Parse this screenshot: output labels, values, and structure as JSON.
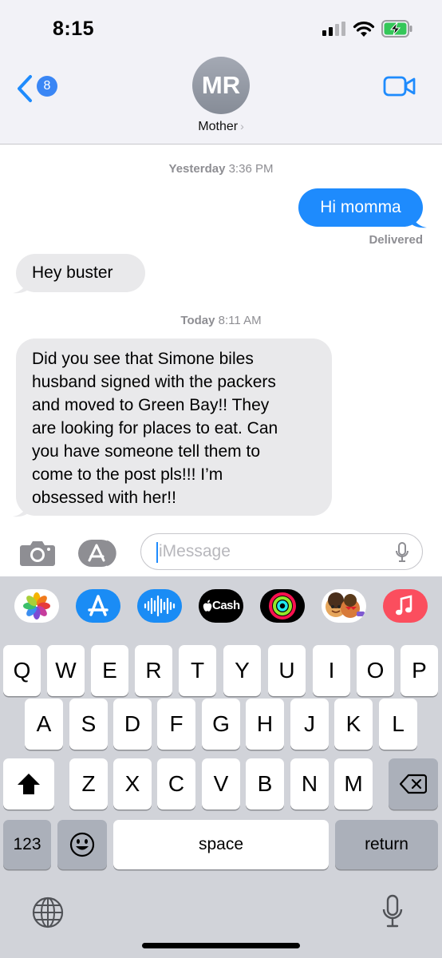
{
  "status_bar": {
    "time": "8:15"
  },
  "header": {
    "back_badge": "8",
    "avatar_initials": "MR",
    "contact_name": "Mother",
    "chevron": "›"
  },
  "messages": {
    "timestamp1_day": "Yesterday",
    "timestamp1_time": "3:36 PM",
    "outgoing1": "Hi momma",
    "delivered": "Delivered",
    "incoming1": "Hey buster",
    "timestamp2_day": "Today",
    "timestamp2_time": "8:11 AM",
    "incoming2_lines": [
      "Did you see that Simone biles",
      "husband signed with the packers",
      "and moved to Green Bay!! They",
      "are looking for places to eat. Can",
      "you have someone tell them to",
      "come to the post pls!!! I’m",
      "obsessed with her!!"
    ]
  },
  "compose": {
    "placeholder": "iMessage"
  },
  "app_strip": {
    "apps": [
      "photos-app",
      "app-store-app",
      "audio-message-app",
      "apple-cash-app",
      "activity-app",
      "memoji-app",
      "music-app"
    ],
    "cash_label": "Cash"
  },
  "keyboard": {
    "row1": [
      "Q",
      "W",
      "E",
      "R",
      "T",
      "Y",
      "U",
      "I",
      "O",
      "P"
    ],
    "row2": [
      "A",
      "S",
      "D",
      "F",
      "G",
      "H",
      "J",
      "K",
      "L"
    ],
    "row3": [
      "Z",
      "X",
      "C",
      "V",
      "B",
      "N",
      "M"
    ],
    "numbers_key": "123",
    "space_key": "space",
    "return_key": "return"
  },
  "colors": {
    "accent": "#1e8bfd",
    "incoming_bubble": "#e9e9eb",
    "keyboard_bg": "#d1d3d9"
  }
}
